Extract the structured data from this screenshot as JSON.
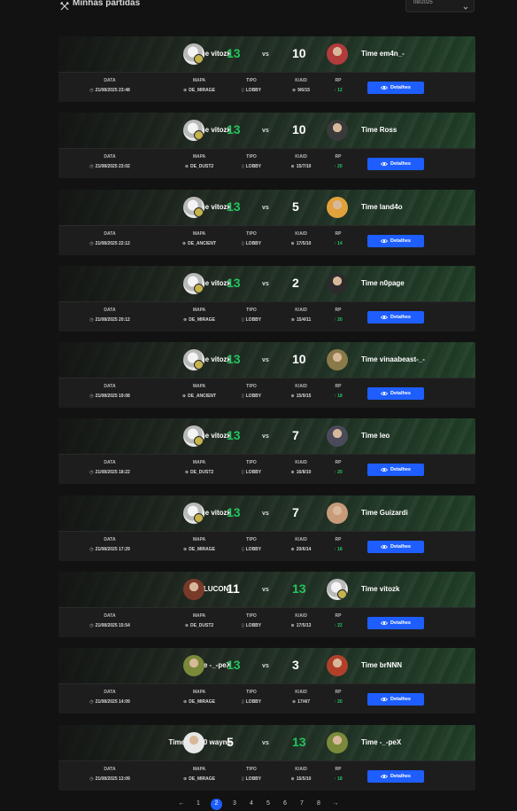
{
  "header": {
    "title": "Minhas partidas",
    "month_select": "08/2025"
  },
  "labels": {
    "date": "DATA",
    "map": "MAPA",
    "type": "TIPO",
    "kad": "K/A/D",
    "rp": "RP",
    "vs": "vs",
    "details": "Detalhes"
  },
  "colors": {
    "win": "#22c55e",
    "primary_button": "#1e5eff",
    "background": "#121212"
  },
  "matches": [
    {
      "team_left": "Time vitozk",
      "score_left": "13",
      "left_win": true,
      "left_avatar": "team-logo",
      "score_right": "10",
      "team_right": "Time em4n_-",
      "right_avatar": "player-avatar",
      "right_color": "#b23b3b",
      "date": "21/08/2025 23:48",
      "map": "DE_MIRAGE",
      "type": "LOBBY",
      "kad": "9/6/15",
      "rp": "12"
    },
    {
      "team_left": "Time vitozk",
      "score_left": "13",
      "left_win": true,
      "left_avatar": "team-logo",
      "score_right": "10",
      "team_right": "Time Ross",
      "right_avatar": "player-avatar",
      "right_color": "#3a3a3a",
      "date": "21/08/2025 23:02",
      "map": "DE_DUST2",
      "type": "LOBBY",
      "kad": "15/7/10",
      "rp": "20"
    },
    {
      "team_left": "Time vitozk",
      "score_left": "13",
      "left_win": true,
      "left_avatar": "team-logo",
      "score_right": "5",
      "team_right": "Time land4o",
      "right_avatar": "player-avatar",
      "right_color": "#e0a23a",
      "date": "21/08/2025 22:12",
      "map": "DE_ANCIENT",
      "type": "LOBBY",
      "kad": "17/5/10",
      "rp": "14"
    },
    {
      "team_left": "Time vitozk",
      "score_left": "13",
      "left_win": true,
      "left_avatar": "team-logo",
      "score_right": "2",
      "team_right": "Time n0page",
      "right_avatar": "player-avatar",
      "right_color": "#2b2b2b",
      "date": "21/08/2025 20:12",
      "map": "DE_MIRAGE",
      "type": "LOBBY",
      "kad": "15/4/11",
      "rp": "20"
    },
    {
      "team_left": "Time vitozk",
      "score_left": "13",
      "left_win": true,
      "left_avatar": "team-logo",
      "score_right": "10",
      "team_right": "Time vinaabeast-_-",
      "right_avatar": "player-avatar",
      "right_color": "#8a7a4a",
      "date": "21/08/2025 19:08",
      "map": "DE_ANCIENT",
      "type": "LOBBY",
      "kad": "15/9/15",
      "rp": "18"
    },
    {
      "team_left": "Time vitozk",
      "score_left": "13",
      "left_win": true,
      "left_avatar": "team-logo",
      "score_right": "7",
      "team_right": "Time leo",
      "right_avatar": "player-avatar",
      "right_color": "#4a4a5a",
      "date": "21/08/2025 18:22",
      "map": "DE_DUST2",
      "type": "LOBBY",
      "kad": "16/8/10",
      "rp": "20"
    },
    {
      "team_left": "Time vitozk",
      "score_left": "13",
      "left_win": true,
      "left_avatar": "team-logo",
      "score_right": "7",
      "team_right": "Time Guizardi",
      "right_avatar": "player-avatar",
      "right_color": "#c79a7a",
      "date": "21/08/2025 17:29",
      "map": "DE_MIRAGE",
      "type": "LOBBY",
      "kad": "20/6/14",
      "rp": "18"
    },
    {
      "team_left": "Time LUCON-",
      "score_left": "11",
      "left_win": false,
      "left_avatar": "player-avatar",
      "left_color": "#7a3a2a",
      "score_right": "13",
      "team_right": "Time vitozk",
      "right_avatar": "team-logo",
      "date": "21/08/2025 15:54",
      "map": "DE_DUST2",
      "type": "LOBBY",
      "kad": "17/5/13",
      "rp": "22"
    },
    {
      "team_left": "Time -_-peX",
      "score_left": "13",
      "left_win": true,
      "left_avatar": "player-avatar",
      "left_color": "#7a8a3a",
      "score_right": "3",
      "team_right": "Time brNNN",
      "right_avatar": "player-avatar",
      "right_color": "#b0402a",
      "date": "21/08/2025 14:09",
      "map": "DE_MIRAGE",
      "type": "LOBBY",
      "kad": "17/4/7",
      "rp": "20"
    },
    {
      "team_left": "Time plpic0 wayne",
      "score_left": "5",
      "left_win": false,
      "left_avatar": "player-avatar",
      "left_color": "#e8e8e8",
      "score_right": "13",
      "team_right": "Time -_-peX",
      "right_avatar": "player-avatar",
      "right_color": "#7a8a3a",
      "date": "21/08/2025 13:09",
      "map": "DE_MIRAGE",
      "type": "LOBBY",
      "kad": "15/5/10",
      "rp": "18"
    }
  ],
  "pagination": {
    "prev": "←",
    "pages": [
      "1",
      "2",
      "3",
      "4",
      "5",
      "6",
      "7",
      "8"
    ],
    "active": "2",
    "next": "→"
  }
}
